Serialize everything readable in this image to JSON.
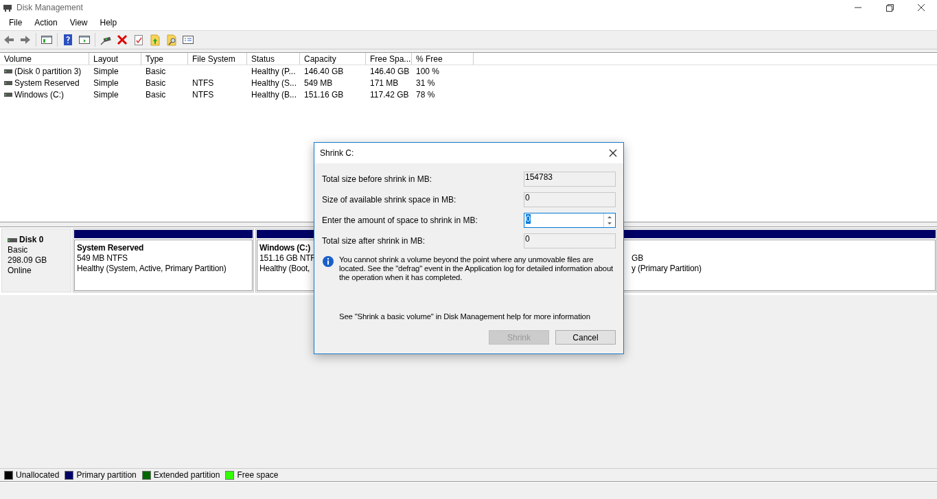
{
  "window": {
    "title": "Disk Management"
  },
  "menu": [
    "File",
    "Action",
    "View",
    "Help"
  ],
  "table": {
    "columns": [
      "Volume",
      "Layout",
      "Type",
      "File System",
      "Status",
      "Capacity",
      "Free Spa...",
      "% Free"
    ],
    "rows": [
      [
        "(Disk 0 partition 3)",
        "Simple",
        "Basic",
        "",
        "Healthy (P...",
        "146.40 GB",
        "146.40 GB",
        "100 %"
      ],
      [
        "System Reserved",
        "Simple",
        "Basic",
        "NTFS",
        "Healthy (S...",
        "549 MB",
        "171 MB",
        "31 %"
      ],
      [
        "Windows (C:)",
        "Simple",
        "Basic",
        "NTFS",
        "Healthy (B...",
        "151.16 GB",
        "117.42 GB",
        "78 %"
      ]
    ]
  },
  "disk": {
    "name": "Disk 0",
    "type": "Basic",
    "size": "298.09 GB",
    "status": "Online",
    "partitions": [
      {
        "name": "System Reserved",
        "size": "549 MB NTFS",
        "status": "Healthy (System, Active, Primary Partition)",
        "color": "#000066"
      },
      {
        "name": "Windows  (C:)",
        "size": "151.16 GB NTF",
        "status": "Healthy (Boot,",
        "color": "#000066"
      },
      {
        "size": "GB",
        "status": "y (Primary Partition)",
        "color": "#000066"
      }
    ]
  },
  "legend": [
    {
      "label": "Unallocated",
      "color": "#000000"
    },
    {
      "label": "Primary partition",
      "color": "#000066"
    },
    {
      "label": "Extended partition",
      "color": "#006600"
    },
    {
      "label": "Free space",
      "color": "#33ff00"
    }
  ],
  "dialog": {
    "title": "Shrink C:",
    "fields": [
      {
        "label": "Total size before shrink in MB:",
        "value": "154783",
        "kind": "readonly"
      },
      {
        "label": "Size of available shrink space in MB:",
        "value": "0",
        "kind": "readonly"
      },
      {
        "label": "Enter the amount of space to shrink in MB:",
        "value": "0",
        "kind": "spin"
      },
      {
        "label": "Total size after shrink in MB:",
        "value": "0",
        "kind": "readonly"
      }
    ],
    "info": "You cannot shrink a volume beyond the point where any unmovable files are located. See the \"defrag\" event in the Application log for detailed information about the operation when it has completed.",
    "help": "See \"Shrink a basic volume\" in Disk Management help for more information",
    "buttons": [
      {
        "label": "Shrink",
        "disabled": true
      },
      {
        "label": "Cancel",
        "disabled": false
      }
    ]
  }
}
